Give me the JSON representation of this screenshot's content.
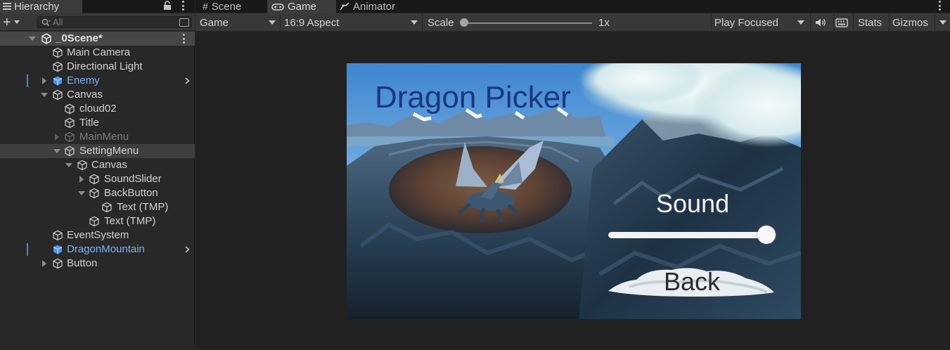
{
  "hierarchy": {
    "tab_label": "Hierarchy",
    "search_placeholder": "All",
    "add_label": "+",
    "scene_name": "_0Scene*",
    "items": [
      {
        "label": "Main Camera"
      },
      {
        "label": "Directional Light"
      },
      {
        "label": "Enemy"
      },
      {
        "label": "Canvas"
      },
      {
        "label": "cloud02"
      },
      {
        "label": "Title"
      },
      {
        "label": "MainMenu"
      },
      {
        "label": "SettingMenu"
      },
      {
        "label": "Canvas"
      },
      {
        "label": "SoundSlider"
      },
      {
        "label": "BackButton"
      },
      {
        "label": "Text (TMP)"
      },
      {
        "label": "Text (TMP)"
      },
      {
        "label": "EventSystem"
      },
      {
        "label": "DragonMountain"
      },
      {
        "label": "Button"
      }
    ]
  },
  "tabs": {
    "scene": "Scene",
    "game": "Game",
    "animator": "Animator"
  },
  "toolbar": {
    "display": "Game",
    "aspect": "16:9 Aspect",
    "scale_label": "Scale",
    "scale_value": "1x",
    "play_mode": "Play Focused",
    "stats": "Stats",
    "gizmos": "Gizmos"
  },
  "game": {
    "title": "Dragon Picker",
    "sound_label": "Sound",
    "slider_value": 1.0,
    "back_label": "Back"
  },
  "colors": {
    "prefab_text": "#7cb2f4",
    "selection_marker": "#3b8be8",
    "title_text": "#1c3680"
  }
}
